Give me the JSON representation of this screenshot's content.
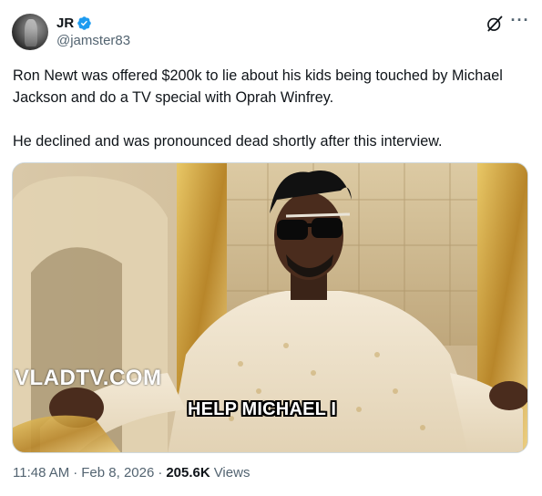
{
  "author": {
    "display_name": "JR",
    "handle": "@jamster83",
    "verified": true,
    "verified_color": "#1d9bf0"
  },
  "header_icons": {
    "grok": "grok-icon",
    "more": "more-icon",
    "more_glyph": "···"
  },
  "tweet": {
    "paragraphs": [
      "Ron Newt was offered $200k to lie about his kids being touched by Michael Jackson and do a TV special with Oprah Winfrey.",
      "He declined and was pronounced dead shortly after this interview."
    ]
  },
  "media": {
    "watermark": "VLADTV.COM",
    "caption": "HELP MICHAEL I"
  },
  "meta": {
    "time": "11:48 AM",
    "date": "Feb 8, 2026",
    "separator": "·",
    "views_count": "205.6K",
    "views_label": "Views"
  }
}
